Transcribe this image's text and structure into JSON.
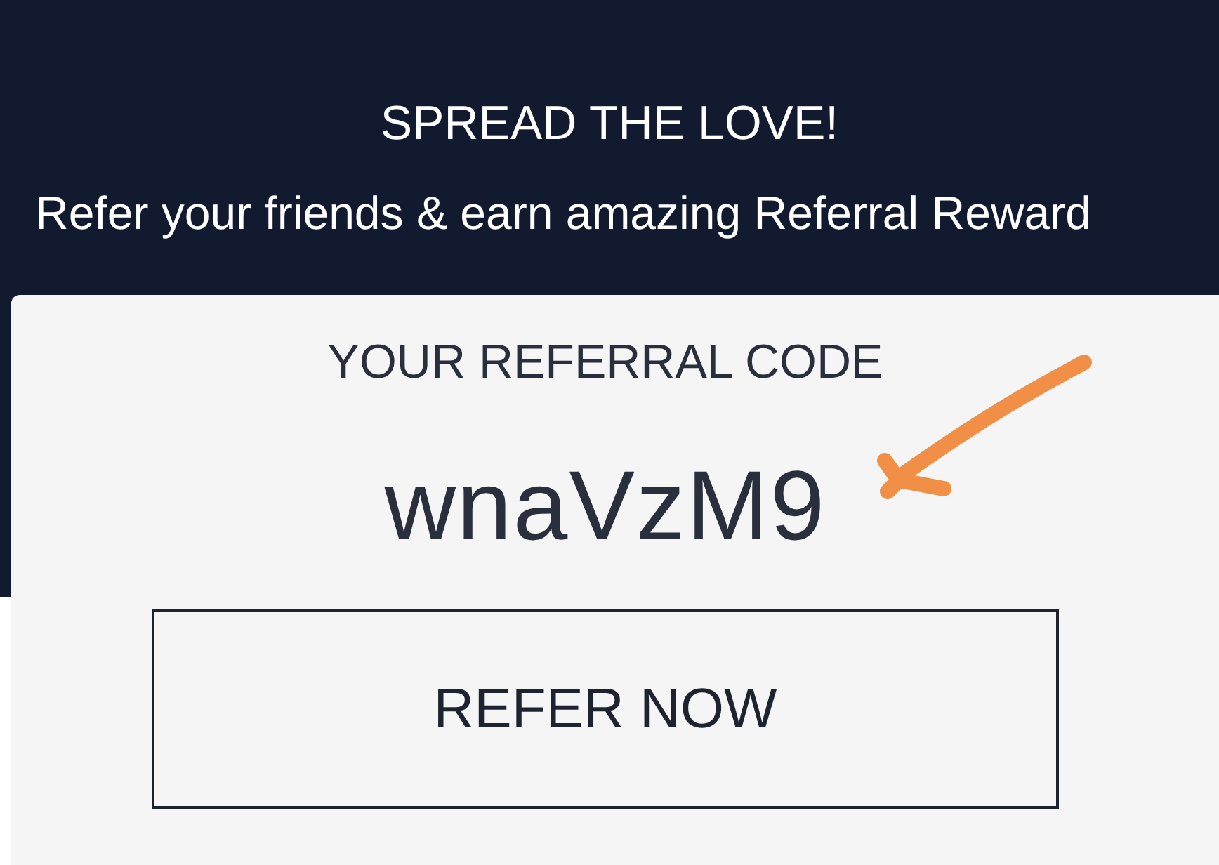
{
  "header": {
    "title": "SPREAD THE LOVE!",
    "subtitle": "Refer your friends & earn amazing Referral Reward"
  },
  "card": {
    "label": "YOUR REFERRAL CODE",
    "code": "wnaVzM9",
    "button": "REFER NOW"
  }
}
